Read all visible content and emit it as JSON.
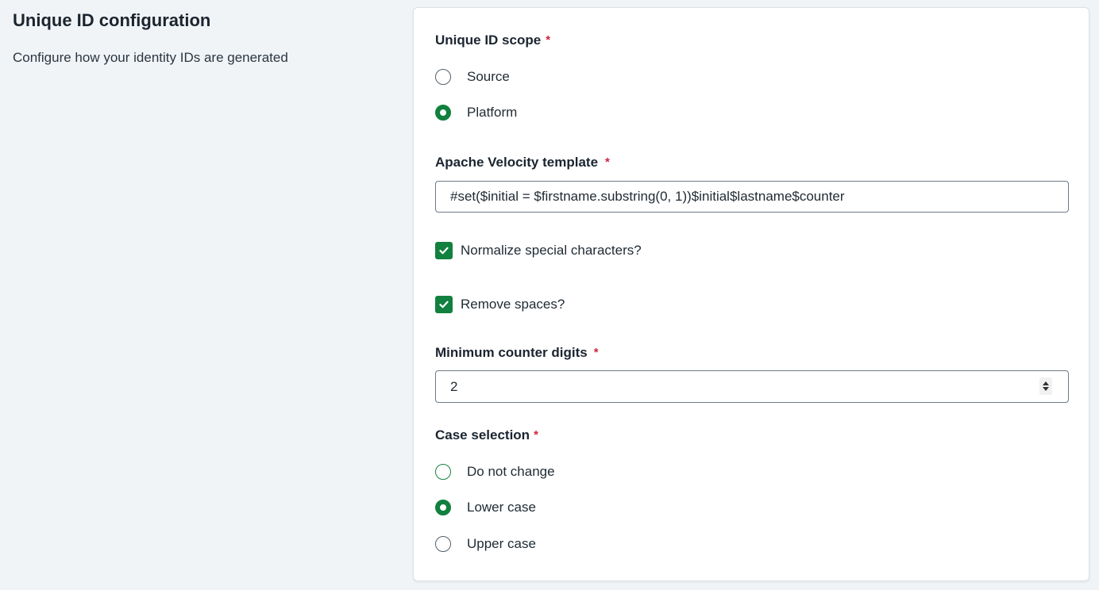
{
  "intro": {
    "title": "Unique ID configuration",
    "description": "Configure how your identity IDs are generated"
  },
  "scope": {
    "label": "Unique ID scope",
    "required_mark": "*",
    "options": [
      {
        "label": "Source",
        "selected": false
      },
      {
        "label": "Platform",
        "selected": true
      }
    ]
  },
  "template": {
    "label": "Apache Velocity template",
    "required_mark": "*",
    "value": "#set($initial = $firstname.substring(0, 1))$initial$lastname$counter"
  },
  "normalize": {
    "label": "Normalize special characters?",
    "checked": true
  },
  "remove_spaces": {
    "label": "Remove spaces?",
    "checked": true
  },
  "counter_digits": {
    "label": "Minimum counter digits",
    "required_mark": "*",
    "value": "2"
  },
  "case_selection": {
    "label": "Case selection",
    "required_mark": "*",
    "options": [
      {
        "label": "Do not change",
        "selected": false
      },
      {
        "label": "Lower case",
        "selected": true
      },
      {
        "label": "Upper case",
        "selected": false
      }
    ]
  },
  "colors": {
    "accent_green": "#12803e",
    "required_red": "#d0243c",
    "background": "#f1f4f7"
  },
  "icons": {
    "checkbox_check": "check-icon",
    "spinner_up": "chevron-up-icon",
    "spinner_down": "chevron-down-icon"
  }
}
